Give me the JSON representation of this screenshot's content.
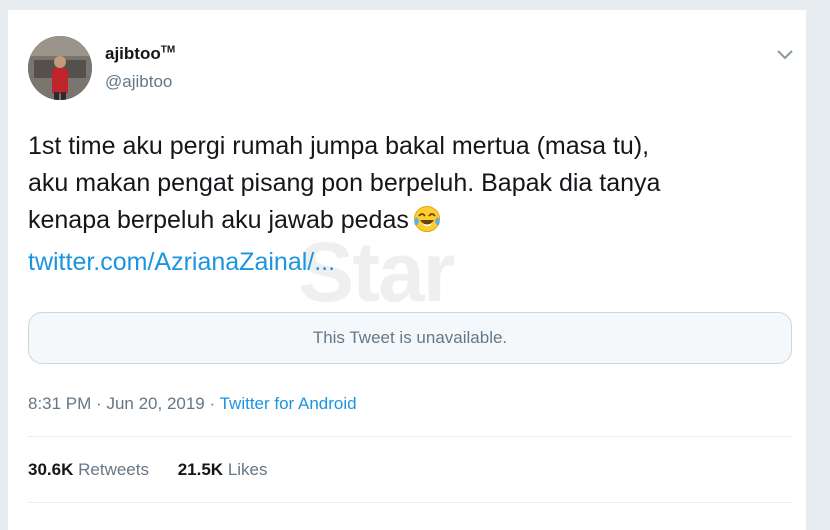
{
  "author": {
    "display_name": "ajibtoo",
    "badge": "TM",
    "handle": "@ajibtoo"
  },
  "tweet": {
    "lines": [
      "1st time aku pergi rumah jumpa bakal mertua (masa tu),",
      "aku makan pengat pisang pon berpeluh. Bapak dia tanya",
      "kenapa berpeluh  aku jawab pedas"
    ],
    "emoji": "face-with-tears-of-joy",
    "link": "twitter.com/AzrianaZainal/..."
  },
  "watermark": "Star",
  "quoted_tweet": {
    "message": "This Tweet is unavailable."
  },
  "meta": {
    "time": "8:31 PM",
    "separator": "·",
    "date": "Jun 20, 2019",
    "source": "Twitter for Android"
  },
  "stats": {
    "retweets_count": "30.6K",
    "retweets_label": "Retweets",
    "likes_count": "21.5K",
    "likes_label": "Likes"
  },
  "icons": {
    "menu": "chevron-down-icon"
  }
}
